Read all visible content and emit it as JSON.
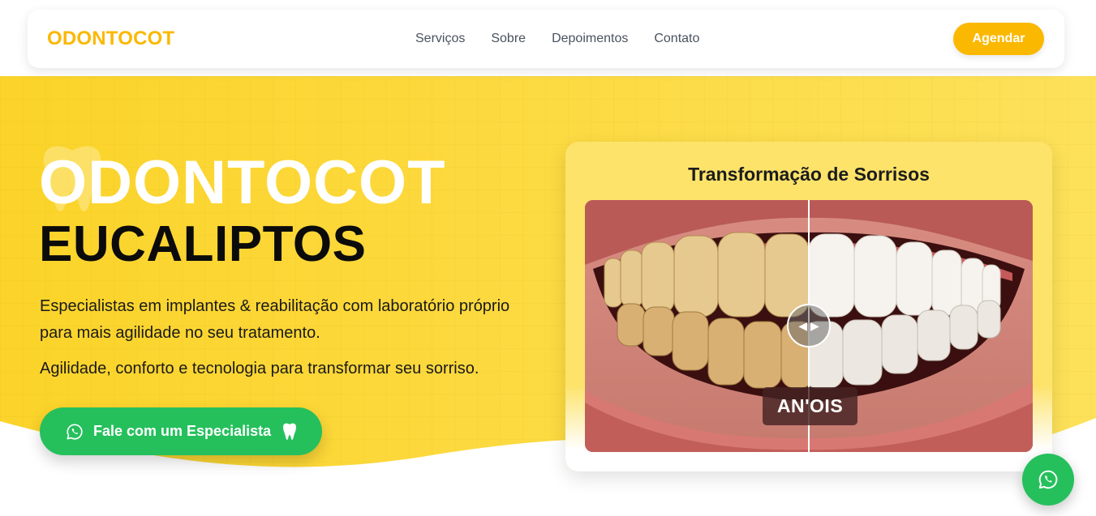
{
  "colors": {
    "brand": "#fbb800",
    "hero_yellow": "#fcd538",
    "whatsapp_green": "#25c05c",
    "card_bg": "#fde36a"
  },
  "header": {
    "brand": "ODONTOCOT",
    "nav": [
      {
        "label": "Serviços"
      },
      {
        "label": "Sobre"
      },
      {
        "label": "Depoimentos"
      },
      {
        "label": "Contato"
      }
    ],
    "cta_label": "Agendar"
  },
  "hero": {
    "title": "ODONTOCOT",
    "subtitle": "EUCALIPTOS",
    "description": "Especialistas em implantes & reabilitação com laboratório próprio para mais agilidade no seu tratamento.",
    "tagline": "Agilidade, conforto e tecnologia para transformar seu sorriso.",
    "whatsapp_button": {
      "label": "Fale com um Especialista",
      "icon": "whatsapp-icon",
      "trailing_icon": "tooth-icon"
    }
  },
  "comparison": {
    "title": "Transformação de Sorrisos",
    "overlay_label": "AN'OIS",
    "handle_icon": "left-right-arrows-icon"
  },
  "floating_button": {
    "icon": "whatsapp-icon"
  }
}
